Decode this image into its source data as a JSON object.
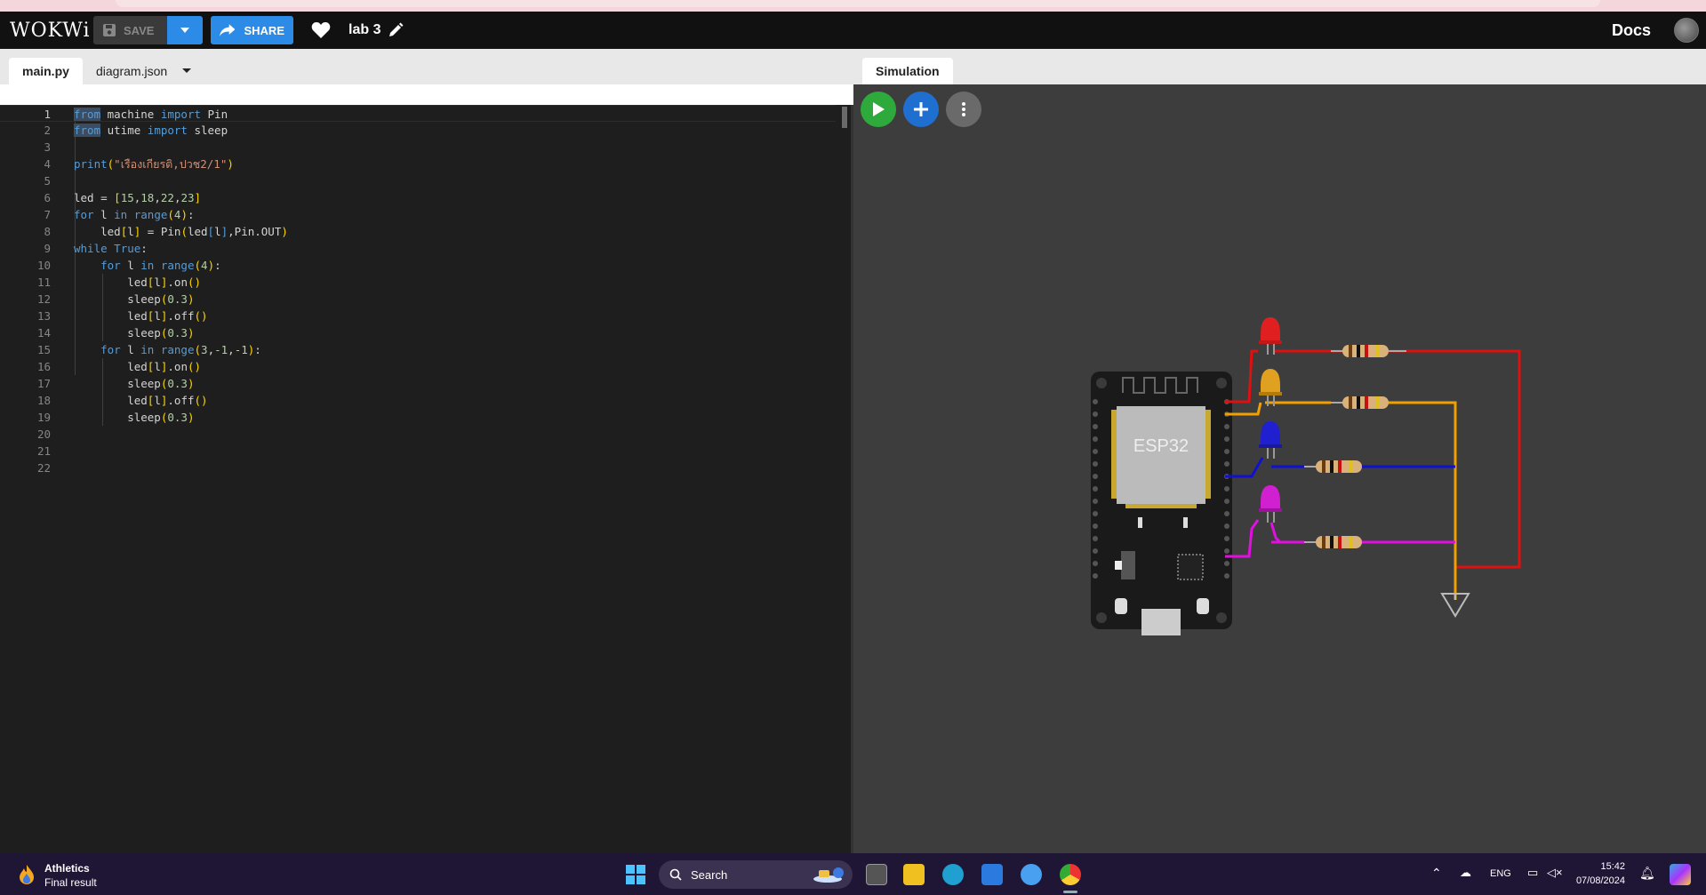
{
  "app": {
    "logo": "WOKWi",
    "save_label": "SAVE",
    "share_label": "SHARE",
    "project_title": "lab 3",
    "docs_label": "Docs"
  },
  "editor": {
    "tabs": [
      {
        "label": "main.py",
        "active": true
      },
      {
        "label": "diagram.json",
        "active": false
      }
    ],
    "line_numbers": [
      "1",
      "2",
      "3",
      "4",
      "5",
      "6",
      "7",
      "8",
      "9",
      "10",
      "11",
      "12",
      "13",
      "14",
      "15",
      "16",
      "17",
      "18",
      "19",
      "20",
      "21",
      "22"
    ],
    "lines": [
      "from machine import Pin",
      "from utime import sleep",
      "",
      "print(\"เรืองเกียรติ,ปวช2/1\")",
      "",
      "led = [15,18,22,23]",
      "for l in range(4):",
      "    led[l] = Pin(led[l],Pin.OUT)",
      "while True:",
      "    for l in range(4):",
      "        led[l].on()",
      "        sleep(0.3)",
      "        led[l].off()",
      "        sleep(0.3)",
      "    for l in range(3,-1,-1):",
      "        led[l].on()",
      "        sleep(0.3)",
      "        led[l].off()",
      "        sleep(0.3)",
      "",
      "",
      ""
    ]
  },
  "simulation": {
    "tab_label": "Simulation",
    "chip_label": "ESP32",
    "led_colors": [
      "#e02020",
      "#e0a020",
      "#2020d0",
      "#d020d0"
    ],
    "wire_colors": [
      "#e01010",
      "#f0a000",
      "#1010d0",
      "#e010e0"
    ]
  },
  "taskbar": {
    "weather_title": "Athletics",
    "weather_sub": "Final result",
    "search_label": "Search",
    "lang": "ENG",
    "time": "15:42",
    "date": "07/08/2024"
  }
}
